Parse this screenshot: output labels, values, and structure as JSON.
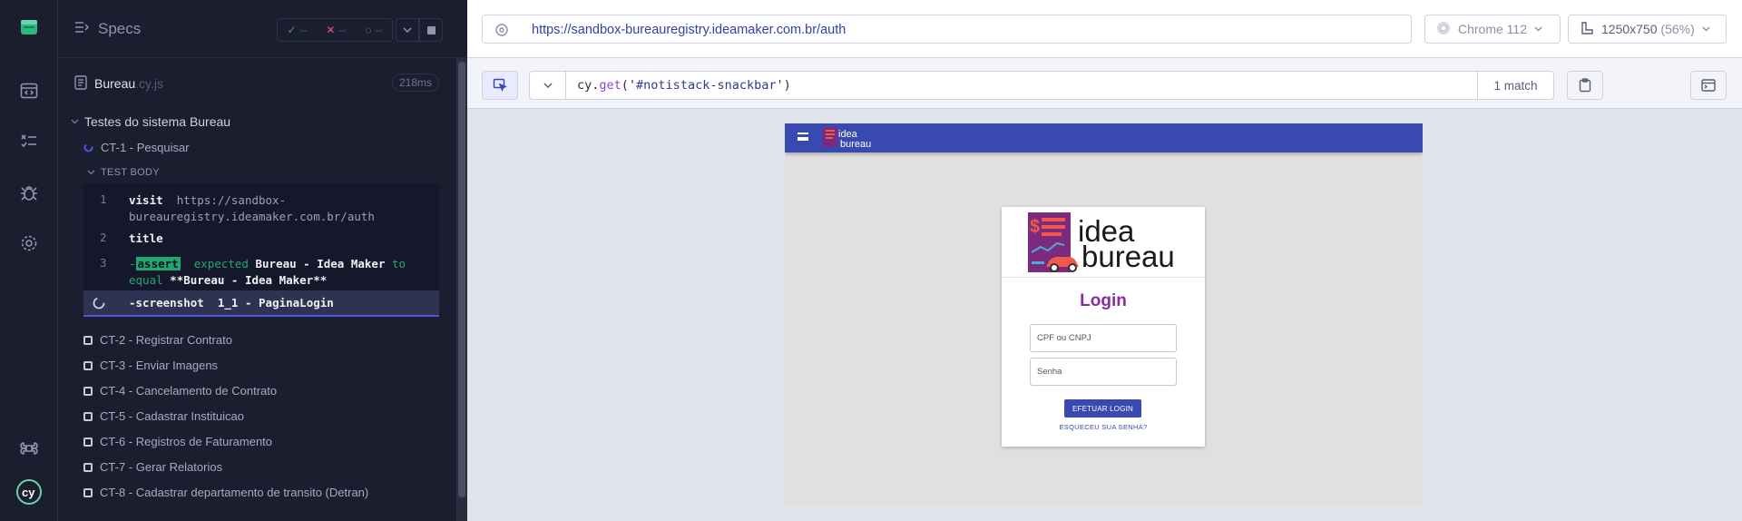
{
  "reporter": {
    "header": {
      "title": "Specs",
      "stats": {
        "passed": {
          "icon": "check-icon",
          "value": "--",
          "color": "#1fa971"
        },
        "failed": {
          "icon": "x-icon",
          "value": "--",
          "color": "#e45770"
        },
        "pending": {
          "icon": "spinner-icon",
          "value": "--",
          "color": "#9095ad"
        }
      }
    },
    "spec": {
      "name": "Bureau",
      "ext": ".cy.js",
      "duration": "218ms"
    },
    "suite": {
      "title": "Testes do sistema Bureau"
    },
    "tests": [
      {
        "title": "CT-1 - Pesquisar",
        "state": "running"
      },
      {
        "title": "CT-2 - Registrar Contrato",
        "state": "pending"
      },
      {
        "title": "CT-3 - Enviar Imagens",
        "state": "pending"
      },
      {
        "title": "CT-4 - Cancelamento de Contrato",
        "state": "pending"
      },
      {
        "title": "CT-5 - Cadastrar Instituicao",
        "state": "pending"
      },
      {
        "title": "CT-6 - Registros de Faturamento",
        "state": "pending"
      },
      {
        "title": "CT-7 - Gerar Relatorios",
        "state": "pending"
      },
      {
        "title": "CT-8 - Cadastrar departamento de transito (Detran)",
        "state": "pending"
      }
    ],
    "test_body_label": "TEST BODY",
    "commands": [
      {
        "num": "1",
        "name": "visit",
        "message": "https://sandbox-bureauregistry.ideamaker.com.br/auth"
      },
      {
        "num": "2",
        "name": "title",
        "message": ""
      },
      {
        "num": "3",
        "prefix": "-",
        "name": "assert",
        "message_a": "expected",
        "message_b": "Bureau - Idea Maker",
        "message_c": "to equal",
        "message_d": "**Bureau - Idea Maker**"
      },
      {
        "num": "",
        "prefix": "-",
        "name": "screenshot",
        "message": "1_1 - PaginaLogin",
        "state": "active"
      }
    ]
  },
  "aut": {
    "url": "https://sandbox-bureauregistry.ideamaker.com.br/auth",
    "browser": "Chrome 112",
    "viewport": "1250x750",
    "viewport_scale": "(56%)",
    "selector": {
      "prefix": "cy.",
      "fn": "get",
      "open": "('",
      "arg": "#notistack-snackbar",
      "close": "')"
    },
    "matches": "1 match"
  },
  "app": {
    "mini_logo_text": [
      "idea",
      "bureau"
    ],
    "logo_text": [
      "idea",
      "bureau"
    ],
    "login_title": "Login",
    "cpf_placeholder": "CPF ou CNPJ",
    "senha_placeholder": "Senha",
    "login_button": "EFETUAR LOGIN",
    "forgot_link": "ESQUECEU SUA SENHA?"
  }
}
